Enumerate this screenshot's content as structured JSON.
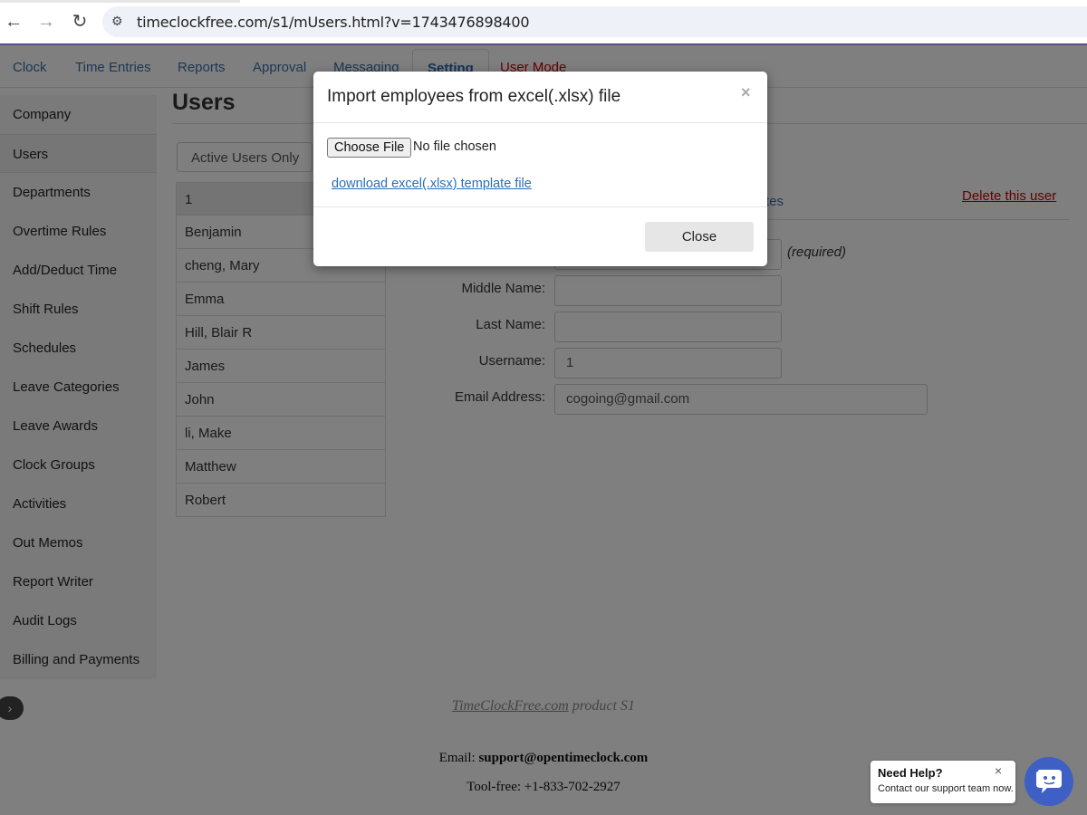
{
  "browser": {
    "url": "timeclockfree.com/s1/mUsers.html?v=1743476898400",
    "back_icon": "arrow-left",
    "forward_icon": "arrow-right",
    "reload_icon": "reload",
    "site_info_icon": "tune"
  },
  "tabs": [
    {
      "label": "Clock"
    },
    {
      "label": "Time Entries"
    },
    {
      "label": "Reports"
    },
    {
      "label": "Approval"
    },
    {
      "label": "Messaging"
    },
    {
      "label": "Setting"
    },
    {
      "label": "User Mode"
    }
  ],
  "sidebar": {
    "items": [
      {
        "label": "Company"
      },
      {
        "label": "Users"
      },
      {
        "label": "Departments"
      },
      {
        "label": "Overtime Rules"
      },
      {
        "label": "Add/Deduct Time"
      },
      {
        "label": "Shift Rules"
      },
      {
        "label": "Schedules"
      },
      {
        "label": "Leave Categories"
      },
      {
        "label": "Leave Awards"
      },
      {
        "label": "Clock Groups"
      },
      {
        "label": "Activities"
      },
      {
        "label": "Out Memos"
      },
      {
        "label": "Report Writer"
      },
      {
        "label": "Audit Logs"
      },
      {
        "label": "Billing and Payments"
      }
    ],
    "collapse_icon": "chevron-right"
  },
  "main": {
    "title": "Users",
    "filter_select": "Active Users Only",
    "users": [
      "1",
      "Benjamin",
      "cheng, Mary",
      "Emma",
      "Hill, Blair R",
      "James",
      "John",
      "li, Make",
      "Matthew",
      "Robert"
    ],
    "detail_tab_fragment": "tes",
    "delete_link": "Delete this user",
    "form": {
      "required_note": "(required)",
      "middle_name_label": "Middle Name:",
      "middle_name_value": "",
      "last_name_label": "Last Name:",
      "last_name_value": "",
      "username_label": "Username:",
      "username_value": "1",
      "email_label": "Email Address:",
      "email_value": "cogoing@gmail.com"
    }
  },
  "footer": {
    "product_link": "TimeClockFree.com",
    "product_suffix": " product S1",
    "email_label": "Email: ",
    "email_value": "support@opentimeclock.com",
    "phone": "Tool-free: +1-833-702-2927"
  },
  "modal": {
    "title": "Import employees from excel(.xlsx) file",
    "close_x": "×",
    "choose_file_label": "Choose File",
    "file_status": "No file chosen",
    "template_link": "download excel(.xlsx) template file",
    "close_button": "Close"
  },
  "help": {
    "title": "Need Help?",
    "subtitle": "Contact our support team now.",
    "close_x": "×",
    "chat_icon": "chat-bubble"
  },
  "colors": {
    "link_blue": "#2a6eb8",
    "danger_red": "#cc0000",
    "chat_blue": "#3e5fc4",
    "overlay": "rgba(0,0,0,0.5)"
  }
}
